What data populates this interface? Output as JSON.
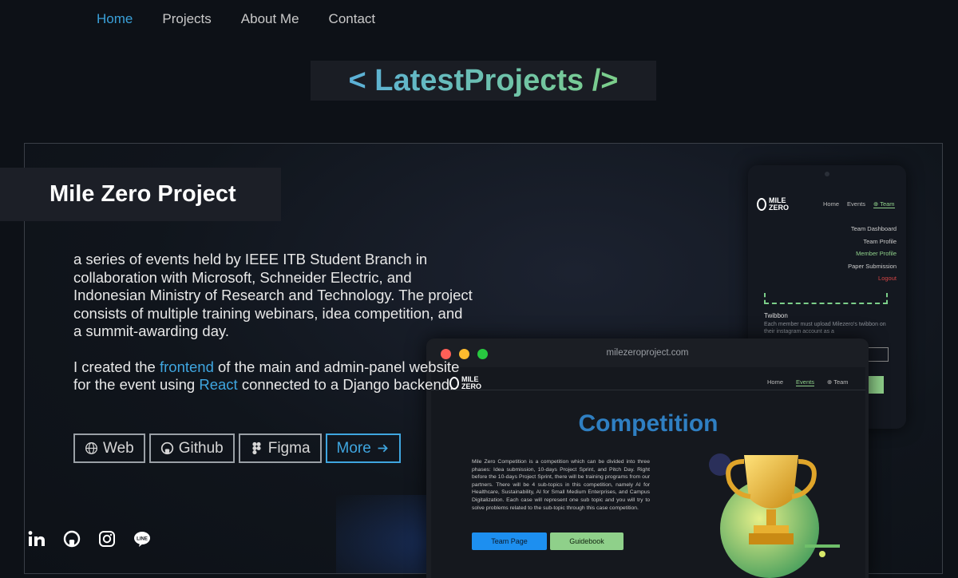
{
  "nav": {
    "items": [
      "Home",
      "Projects",
      "About Me",
      "Contact"
    ],
    "active": "Home"
  },
  "section_title": "< LatestProjects />",
  "project": {
    "title": "Mile Zero Project",
    "description1": "a series of events held by IEEE ITB Student Branch in collaboration with Microsoft, Schneider Electric, and Indonesian Ministry of Research and Technology. The project consists of multiple training webinars, idea competition, and a summit-awarding day.",
    "d2_pre": "I created the ",
    "d2_link1": "frontend",
    "d2_mid": " of the main and admin-panel website for the event using ",
    "d2_link2": "React",
    "d2_post": " connected to a Django backend.",
    "buttons": {
      "web": "Web",
      "github": "Github",
      "figma": "Figma",
      "more": "More"
    }
  },
  "social": [
    "linkedin-icon",
    "github-icon",
    "instagram-icon",
    "line-icon"
  ],
  "phone": {
    "logo_top": "MILE",
    "logo_bottom": "ZERO",
    "nav": [
      "Home",
      "Events",
      "Team"
    ],
    "menu": [
      "Team Dashboard",
      "Team Profile",
      "Member Profile",
      "Paper Submission",
      "Logout"
    ],
    "twibbon_label": "Twibbon",
    "twibbon_desc": "Each member must upload Milezero's twibbon on their instagram account as a"
  },
  "browser": {
    "url": "milezeroproject.com",
    "logo_top": "MILE",
    "logo_bottom": "ZERO",
    "nav": [
      "Home",
      "Events",
      "Team"
    ],
    "heading": "Competition",
    "text": "Mile Zero Competition is a competition which can be divided into three phases: Idea submission, 10-days Project Sprint, and Pitch Day. Right before the 10-days Project Sprint, there will be training programs from our partners. There will be 4 sub-topics in this competition, namely AI for Healthcare, Sustainability, AI for Small Medium Enterprises, and Campus Digitalization. Each case will represent one sub topic and you will try to solve problems related to the sub-topic through this case competition.",
    "team_btn": "Team Page",
    "guide_btn": "Guidebook"
  },
  "colors": {
    "accent": "#3fa6e0",
    "green": "#8fd08a",
    "bg": "#0d1117"
  }
}
